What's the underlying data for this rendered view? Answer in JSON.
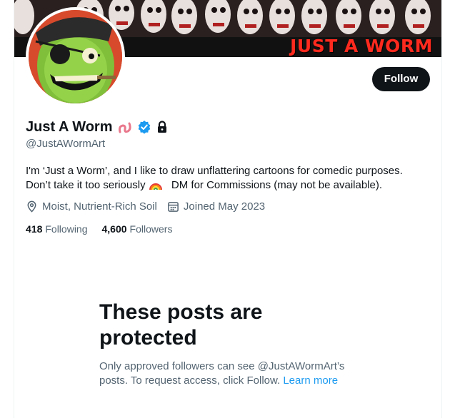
{
  "banner": {
    "text": "JUST A WORM"
  },
  "profile": {
    "display_name": "Just A Worm",
    "handle": "@JustAWormArt",
    "bio_line1": "I'm ‘Just a Worm’, and I like to draw unflattering cartoons for comedic purposes.",
    "bio_line2_before": "Don’t take it too seriously",
    "bio_line2_after": "DM for Commissions (may not be available).",
    "location": "Moist, Nutrient-Rich Soil",
    "joined": "Joined May 2023",
    "following_count": "418",
    "following_label": "Following",
    "followers_count": "4,600",
    "followers_label": "Followers"
  },
  "actions": {
    "follow_label": "Follow"
  },
  "protected": {
    "title_line1": "These posts are",
    "title_line2": "protected",
    "body_line1": "Only approved followers can see @JustAWormArt’s",
    "body_line2": "posts. To request access, click Follow.",
    "learn_more": "Learn more"
  },
  "icons": {
    "worm": "worm-emoji-icon",
    "verified": "verified-badge-icon",
    "lock": "lock-icon",
    "rainbow": "rainbow-emoji-icon",
    "location": "location-pin-icon",
    "calendar": "calendar-icon"
  },
  "colors": {
    "accent": "#1d9bf0",
    "text": "#0f1419",
    "muted": "#536471",
    "banner_text": "#ff2a1e",
    "button_bg": "#0f1419"
  }
}
